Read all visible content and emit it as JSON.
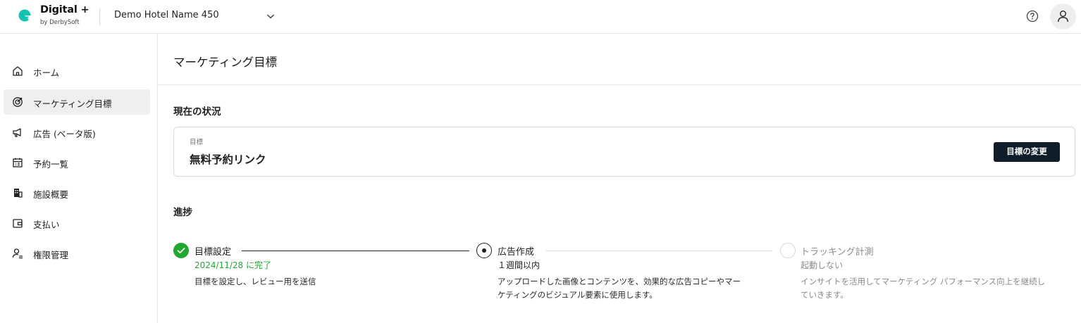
{
  "header": {
    "brand_title": "Digital +",
    "brand_sub": "by DerbySoft",
    "hotel_name": "Demo Hotel Name 450"
  },
  "sidebar": {
    "items": [
      {
        "label": "ホーム",
        "icon": "home-icon"
      },
      {
        "label": "マーケティング目標",
        "icon": "target-icon",
        "active": true
      },
      {
        "label": "広告 (ベータ版)",
        "icon": "megaphone-icon"
      },
      {
        "label": "予約一覧",
        "icon": "calendar-list-icon"
      },
      {
        "label": "施設概要",
        "icon": "building-icon"
      },
      {
        "label": "支払い",
        "icon": "wallet-icon"
      },
      {
        "label": "権限管理",
        "icon": "user-settings-icon"
      }
    ]
  },
  "main": {
    "page_title": "マーケティング目標",
    "current_status_title": "現在の状況",
    "goal_label": "目標",
    "goal_value": "無料予約リンク",
    "change_goal_button": "目標の変更",
    "progress_title": "進捗",
    "steps": [
      {
        "title": "目標設定",
        "sub": "2024/11/28 に完了",
        "desc": "目標を設定し、レビュー用を送信",
        "status": "done"
      },
      {
        "title": "広告作成",
        "sub": "１週間以内",
        "desc_1": "アップロードした画像とコンテンツを、効果的な広告コピーやマー",
        "desc_2": "ケティングのビジュアル要素に使用します。",
        "status": "current"
      },
      {
        "title": "トラッキング計測",
        "sub": "起動しない",
        "desc_1": "インサイトを活用してマーケティング パフォーマンス向上を継続し",
        "desc_2": "ていきます。",
        "status": "pending"
      }
    ]
  },
  "colors": {
    "accent_green": "#22a831",
    "logo_teal": "#13c2b3",
    "button_dark": "#0f1d2b"
  }
}
